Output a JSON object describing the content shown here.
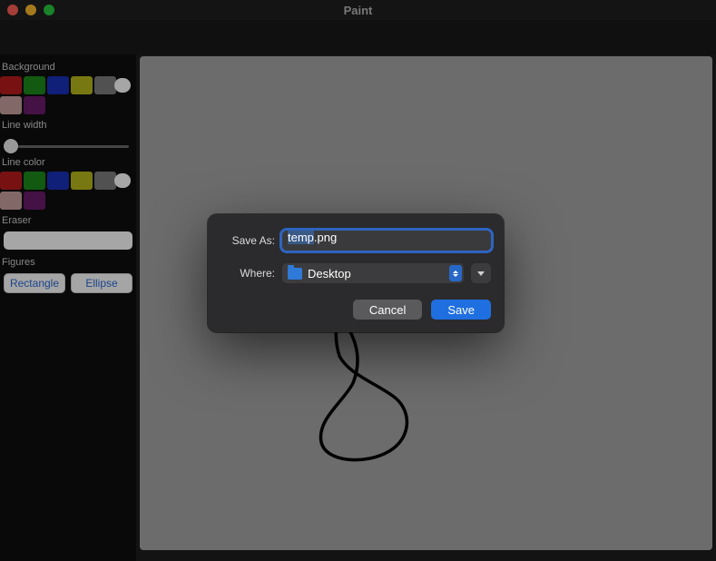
{
  "window": {
    "title": "Paint"
  },
  "sidebar": {
    "background_label": "Background",
    "bg_colors_row1": [
      "#b81c1c",
      "#1c8a1c",
      "#1930b8",
      "#b8b81c",
      "#7d7d7d"
    ],
    "bg_colors_row2": [
      "#c9a0a0",
      "#6b1c6b"
    ],
    "recent_bg": "#ffffff",
    "line_width_label": "Line width",
    "line_color_label": "Line color",
    "lc_colors_row1": [
      "#b81c1c",
      "#1c8a1c",
      "#1930b8",
      "#b8b81c",
      "#7d7d7d"
    ],
    "lc_colors_row2": [
      "#c9a0a0",
      "#6b1c6b"
    ],
    "recent_lc": "#ffffff",
    "eraser_label": "Eraser",
    "figures_label": "Figures",
    "figure_buttons": [
      "Rectangle",
      "Ellipse"
    ]
  },
  "dialog": {
    "save_as_label": "Save As:",
    "filename_selected": "temp",
    "filename_ext": ".png",
    "where_label": "Where:",
    "where_value": "Desktop",
    "cancel": "Cancel",
    "save": "Save"
  }
}
